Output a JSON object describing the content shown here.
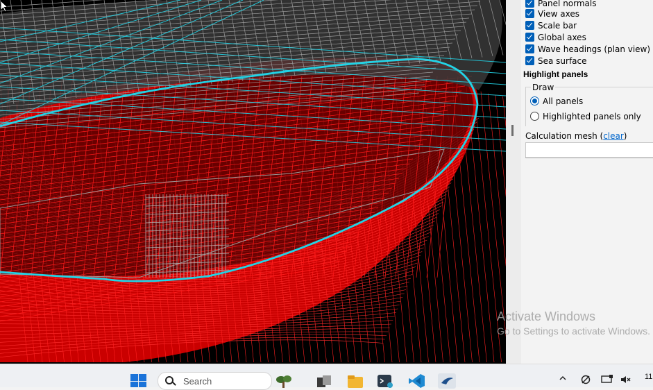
{
  "options": {
    "checkboxes": [
      {
        "label": "Panel normals",
        "checked": true
      },
      {
        "label": "View axes",
        "checked": true
      },
      {
        "label": "Scale bar",
        "checked": true
      },
      {
        "label": "Global axes",
        "checked": true
      },
      {
        "label": "Wave headings (plan view)",
        "checked": true
      },
      {
        "label": "Sea surface",
        "checked": true
      }
    ],
    "highlight_title": "Highlight panels",
    "draw_legend": "Draw",
    "draw_options": [
      {
        "label": "All panels",
        "selected": true
      },
      {
        "label": "Highlighted panels only",
        "selected": false
      }
    ],
    "calc_mesh_label": "Calculation mesh (",
    "calc_mesh_clear": "clear",
    "calc_mesh_close": ")",
    "calc_mesh_value": ""
  },
  "watermark": {
    "title": "Activate Windows",
    "subtitle": "Go to Settings to activate Windows."
  },
  "taskbar": {
    "search_placeholder": "Search",
    "clock_time": "11",
    "apps": [
      "start-icon",
      "search-icon",
      "widgets-icon",
      "task-view-icon",
      "file-explorer-icon",
      "terminal-icon",
      "vscode-icon",
      "pinned-app-icon"
    ]
  },
  "colors": {
    "viewport_bg": "#000000",
    "mesh_red": "#ff0000",
    "mesh_grey": "#9a9a9a",
    "waterline": "#22d3e6",
    "accent": "#005fb8"
  }
}
